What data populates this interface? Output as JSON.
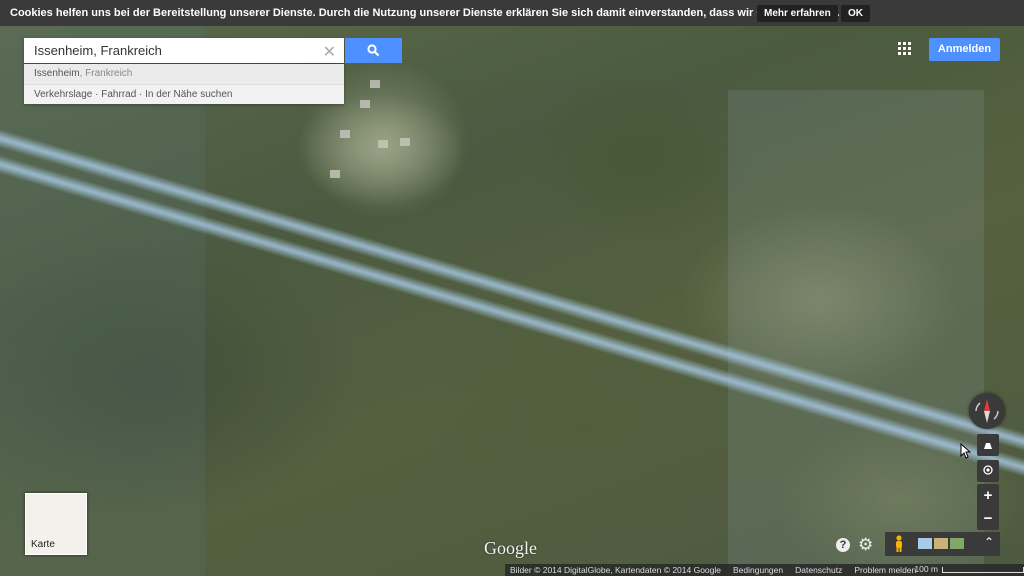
{
  "cookie_bar": {
    "message": "Cookies helfen uns bei der Bereitstellung unserer Dienste. Durch die Nutzung unserer Dienste erklären Sie sich damit einverstanden, dass wir Cookies setzen.",
    "more_label": "Mehr erfahren",
    "ok_label": "OK"
  },
  "search": {
    "value": "Issenheim, Frankreich",
    "button_icon": "search-icon"
  },
  "suggestions": {
    "place_name": "Issenheim",
    "place_sub": ", Frankreich",
    "actions": "Verkehrslage · Fahrrad · In der Nähe suchen"
  },
  "header": {
    "apps_icon": "apps-grid-icon",
    "signin_label": "Anmelden"
  },
  "map_type": {
    "label": "Karte"
  },
  "logo": {
    "text": "Google"
  },
  "controls": {
    "compass_icon": "compass-icon",
    "zoom_in": "+",
    "zoom_out": "−"
  },
  "footer": {
    "attribution": "Bilder © 2014 DigitalGlobe, Kartendaten © 2014 Google",
    "terms": "Bedingungen",
    "privacy": "Datenschutz",
    "report": "Problem melden",
    "scale": "100 m"
  },
  "colors": {
    "accent": "#4d90fe",
    "bar": "#3a3a3a"
  }
}
